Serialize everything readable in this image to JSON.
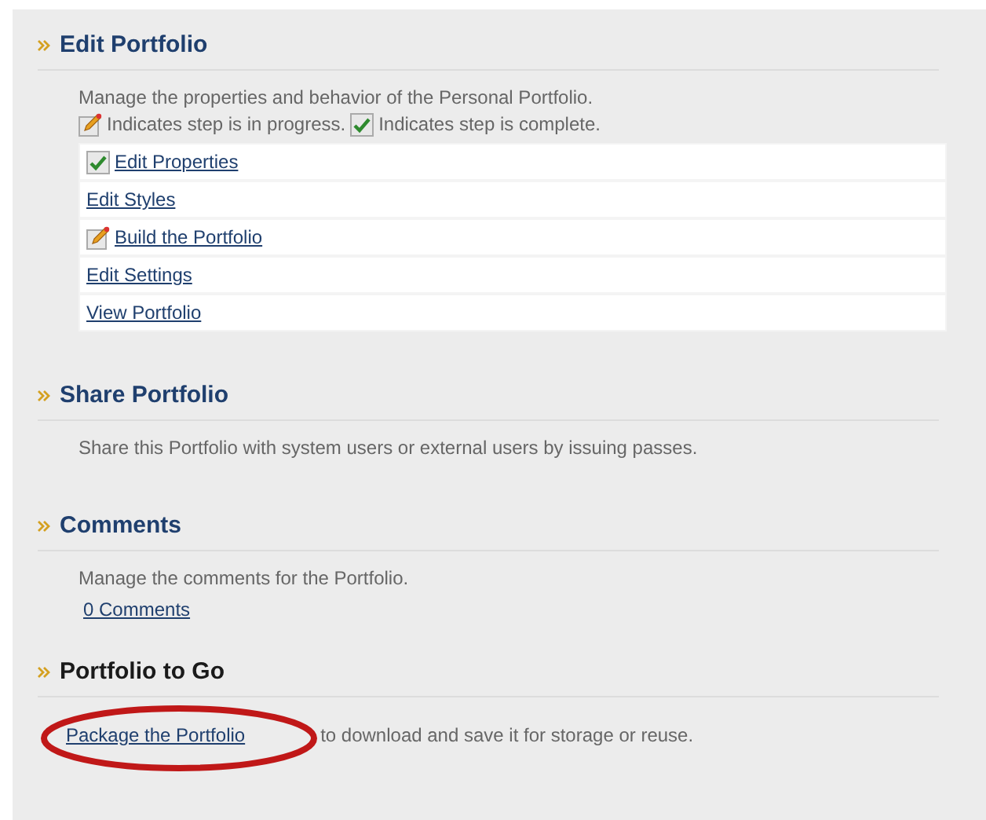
{
  "sections": [
    {
      "title": "Edit Portfolio",
      "kind": "steps",
      "description": "Manage the properties and behavior of the Personal Portfolio.",
      "legend": [
        {
          "kind": "in_progress",
          "text": "Indicates step is in progress."
        },
        {
          "kind": "complete",
          "text": "Indicates step is complete."
        }
      ],
      "steps": [
        {
          "label": "Edit Properties",
          "kind": "complete"
        },
        {
          "label": "Edit Styles",
          "kind": "plain"
        },
        {
          "label": "Build the Portfolio",
          "kind": "in_progress"
        },
        {
          "label": "Edit Settings",
          "kind": "plain"
        },
        {
          "label": "View Portfolio",
          "kind": "plain"
        }
      ]
    },
    {
      "title": "Share Portfolio",
      "kind": "text",
      "description": "Share this Portfolio with system users or external users by issuing passes."
    },
    {
      "title": "Comments",
      "kind": "link",
      "description": "Manage the comments for the Portfolio.",
      "link": "0 Comments"
    },
    {
      "title": "Portfolio to Go",
      "kind": "inline_link",
      "link": "Package the Portfolio",
      "rest": "to download and save it for storage or reuse.",
      "circled": true
    }
  ]
}
